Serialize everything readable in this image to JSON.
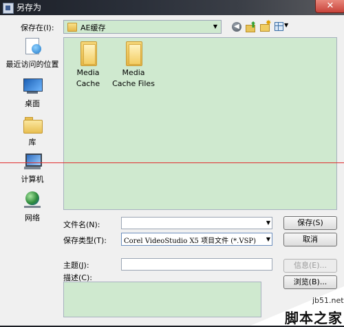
{
  "window": {
    "title": "另存为",
    "close_glyph": "✕"
  },
  "top_row": {
    "save_in_label": "保存在(I):",
    "location": "AE缓存",
    "icons": {
      "back": "back-icon",
      "up": "up-folder-icon",
      "new_folder": "new-folder-icon",
      "view": "view-menu-icon"
    }
  },
  "places": [
    {
      "label": "最近访问的位置",
      "icon": "recent-places-icon"
    },
    {
      "label": "桌面",
      "icon": "desktop-icon"
    },
    {
      "label": "库",
      "icon": "library-icon"
    },
    {
      "label": "计算机",
      "icon": "computer-icon"
    },
    {
      "label": "网络",
      "icon": "network-icon"
    }
  ],
  "files": [
    {
      "line1": "Media",
      "line2": "Cache",
      "icon": "folder-icon"
    },
    {
      "line1": "Media",
      "line2": "Cache Files",
      "icon": "folder-icon"
    }
  ],
  "form": {
    "filename_label": "文件名(N):",
    "filename_value": "",
    "filetype_label": "保存类型(T):",
    "filetype_value": "Corel VideoStudio X5 项目文件 (*.VSP)",
    "subject_label": "主题(J):",
    "subject_value": "",
    "description_label": "描述(C):"
  },
  "buttons": {
    "save": "保存(S)",
    "cancel": "取消",
    "info": "信息(E)...",
    "browse": "浏览(B)..."
  },
  "watermark": {
    "site": "jb51.net",
    "text": "脚本之家"
  },
  "colors": {
    "list_background": "#cfe9cf",
    "red_line": "#e03030"
  }
}
